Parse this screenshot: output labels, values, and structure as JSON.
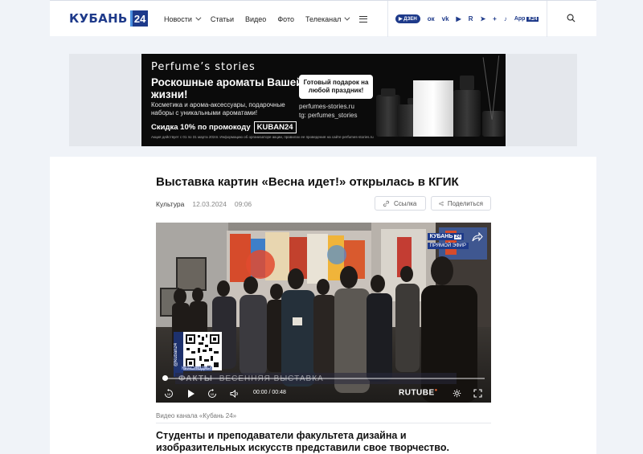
{
  "header": {
    "logo_text": "КУБАНЬ",
    "logo_num": "24",
    "nav": [
      {
        "label": "Новости",
        "dropdown": true
      },
      {
        "label": "Статьи",
        "dropdown": false
      },
      {
        "label": "Видео",
        "dropdown": false
      },
      {
        "label": "Фото",
        "dropdown": false
      },
      {
        "label": "Телеканал",
        "dropdown": true
      }
    ],
    "socials": {
      "dzen": "▶ ДЗЕН",
      "ok": "ок",
      "vk": "vk",
      "youtube": "▶",
      "rutube": "R",
      "telegram": "➤",
      "plus": "+",
      "tiktok": "♪",
      "app": "App",
      "app_sub": "K24"
    }
  },
  "ad": {
    "brand": "Perfume’s stories",
    "headline": "Роскошные ароматы Вашей жизни!",
    "sub": "Косметика и арома-аксессуары, подарочные наборы с уникальными ароматами!",
    "promo_text": "Скидка 10% по промокоду",
    "promo_code": "KUBAN24",
    "gift": "Готовый подарок на любой праздник!",
    "site": "perfumes-stories.ru",
    "tg": "tg: perfumes_stories",
    "fine": "Акция действует с 01 по 31 марта 2024г. Информацию об организаторе акции, правилах ее проведения на сайте perfumes-stories.ru",
    "bottle_label": "Perfume’s stories"
  },
  "article": {
    "title": "Выставка картин «Весна идет!» открылась в КГИК",
    "category": "Культура",
    "date": "12.03.2024",
    "time": "09:06",
    "link_label": "Ссылка",
    "share_label": "Поделиться",
    "caption": "Видео канала «Кубань 24»",
    "lead": "Студенты и преподаватели факультета дизайна и изобразительных искусств представили свое творчество."
  },
  "video": {
    "channel_badge": "КУБАНЬ",
    "channel_num": "24",
    "live_label": "ПРЯМОЙ ЭФИР",
    "qr_handle": "@kuban24",
    "city": "КРАСНОДАР",
    "ticker_left": "ФАКТЫ",
    "ticker_right": "ВЕСЕННЯЯ ВЫСТАВКА",
    "time_display": "00:00 / 00:48",
    "player_brand": "RUTUBE",
    "progress": 0,
    "rewind_label": "10",
    "forward_label": "10"
  }
}
